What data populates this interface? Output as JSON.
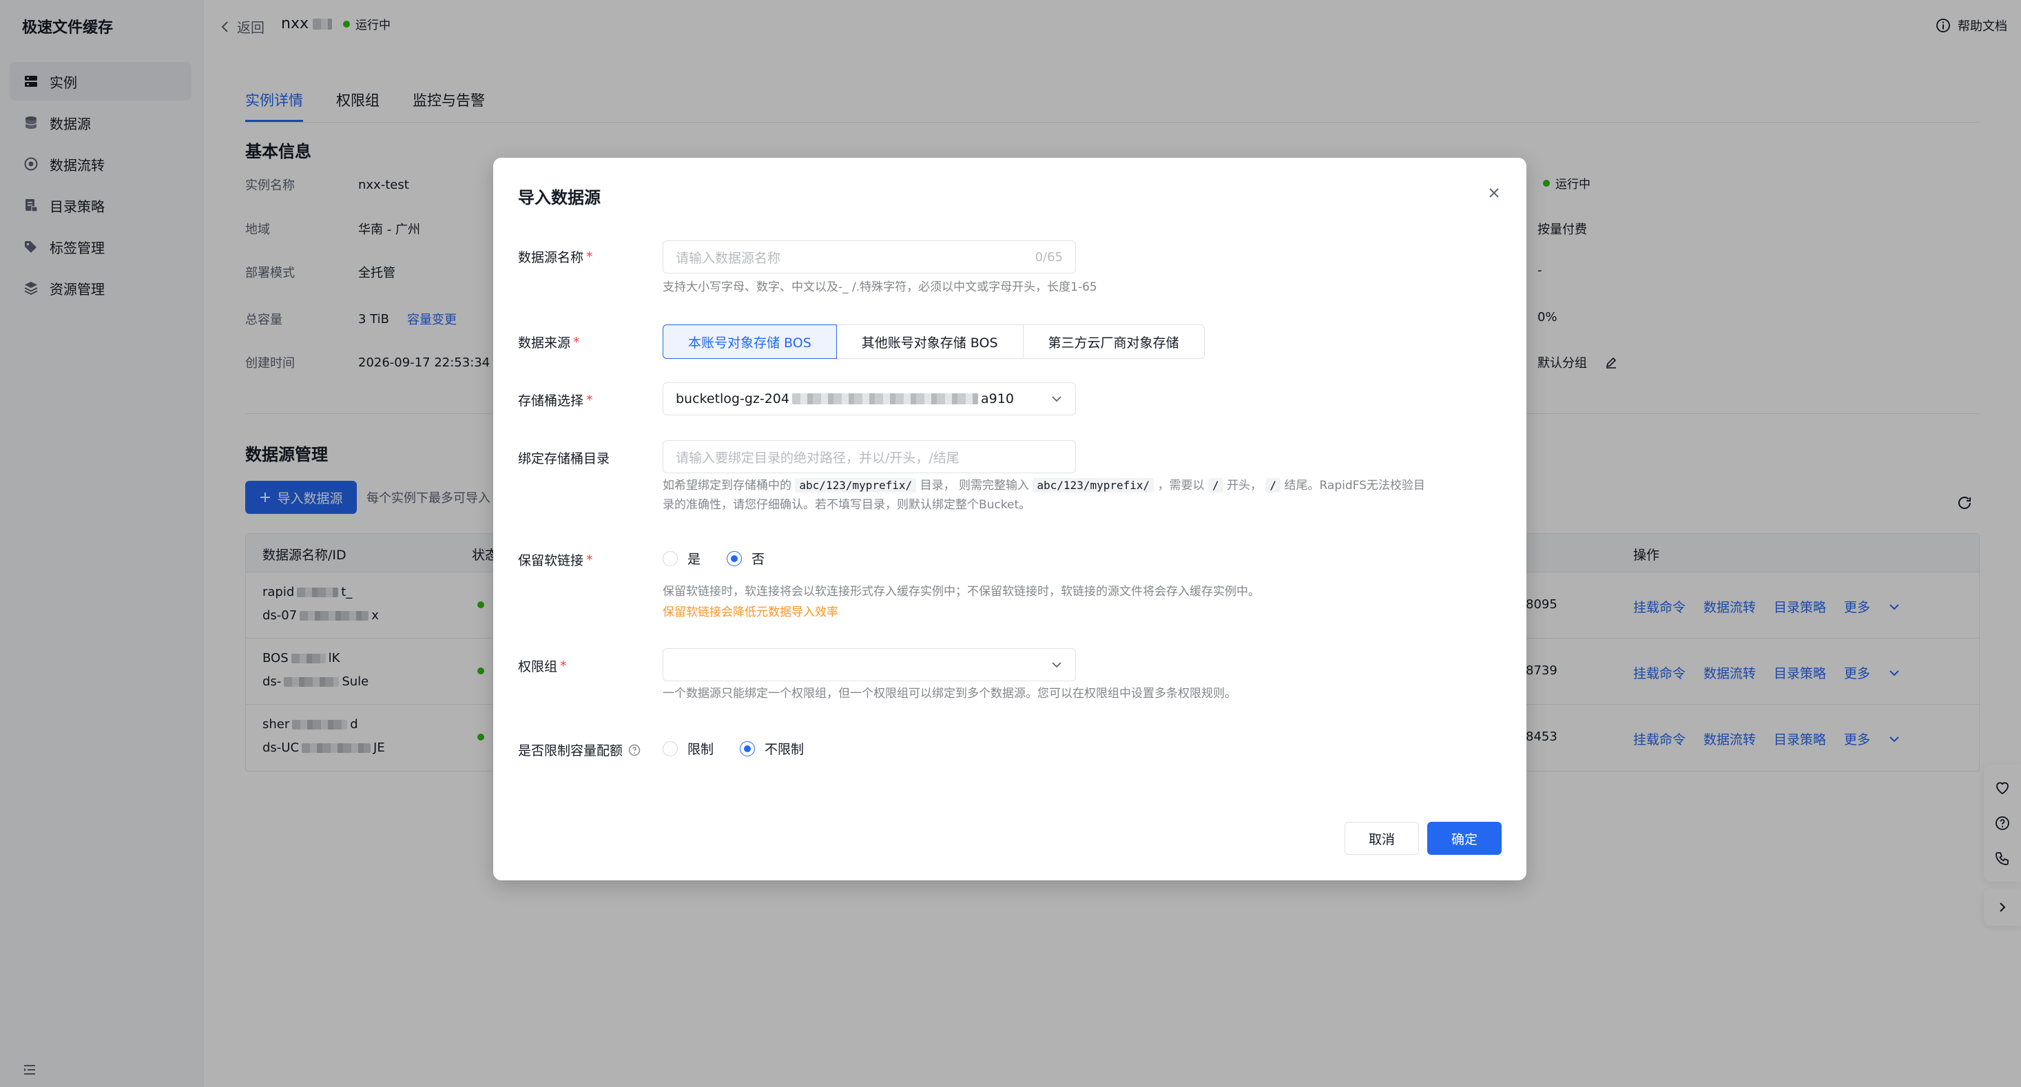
{
  "app": {
    "title": "极速文件缓存"
  },
  "sidebar": {
    "items": [
      {
        "label": "实例",
        "icon": "instance-icon",
        "active": true
      },
      {
        "label": "数据源",
        "icon": "database-icon",
        "active": false
      },
      {
        "label": "数据流转",
        "icon": "flow-icon",
        "active": false
      },
      {
        "label": "目录策略",
        "icon": "directory-icon",
        "active": false
      },
      {
        "label": "标签管理",
        "icon": "tag-icon",
        "active": false
      },
      {
        "label": "资源管理",
        "icon": "resource-icon",
        "active": false
      }
    ]
  },
  "header": {
    "back_label": "返回",
    "instance_name_prefix": "nxx",
    "status": "运行中",
    "help_label": "帮助文档"
  },
  "tabs": [
    {
      "label": "实例详情",
      "active": true
    },
    {
      "label": "权限组",
      "active": false
    },
    {
      "label": "监控与告警",
      "active": false
    }
  ],
  "basic_info": {
    "title": "基本信息",
    "left": [
      {
        "key": "实例名称",
        "value": "nxx-test"
      },
      {
        "key": "地域",
        "value": "华南 - 广州"
      },
      {
        "key": "部署模式",
        "value": "全托管"
      },
      {
        "key": "总容量",
        "value": "3 TiB",
        "link": "容量变更"
      },
      {
        "key": "创建时间",
        "value": "2026-09-17 22:53:34"
      }
    ],
    "right": [
      {
        "value": "运行中"
      },
      {
        "value": "按量付费"
      },
      {
        "value": "-"
      },
      {
        "value": "0%"
      },
      {
        "value": "默认分组"
      }
    ]
  },
  "datasource_mgmt": {
    "title": "数据源管理",
    "import_button": "导入数据源",
    "import_tip": "每个实例下最多可导入",
    "columns": {
      "name": "数据源名称/ID",
      "status": "状态",
      "ops": "操作"
    },
    "rows": [
      {
        "name_prefix": "rapid",
        "name_suffix": "t_",
        "id_prefix": "ds-07",
        "id_suffix": "x",
        "num": "8095"
      },
      {
        "name_prefix": "BOS",
        "name_suffix": "lK",
        "id_prefix": "ds-",
        "id_suffix": "Sule",
        "num": "8739"
      },
      {
        "name_prefix": "sher",
        "name_suffix": "d",
        "id_prefix": "ds-UC",
        "id_suffix": "JE",
        "num": "8453"
      }
    ],
    "ops": [
      "挂载命令",
      "数据流转",
      "目录策略",
      "更多"
    ]
  },
  "modal": {
    "title": "导入数据源",
    "name_field": {
      "label": "数据源名称",
      "placeholder": "请输入数据源名称",
      "counter": "0/65",
      "hint": "支持大小写字母、数字、中文以及-_ /.特殊字符，必须以中文或字母开头，长度1-65"
    },
    "source_field": {
      "label": "数据来源",
      "options": [
        "本账号对象存储 BOS",
        "其他账号对象存储 BOS",
        "第三方云厂商对象存储"
      ],
      "selected": "本账号对象存储 BOS"
    },
    "bucket_field": {
      "label": "存储桶选择",
      "value_prefix": "bucketlog-gz-204",
      "value_suffix": "a910"
    },
    "dir_field": {
      "label": "绑定存储桶目录",
      "placeholder": "请输入要绑定目录的绝对路径，并以/开头，/结尾",
      "hint_1": "如希望绑定到存储桶中的",
      "hint_code_1": "abc/123/myprefix/",
      "hint_2": "目录， 则需完整输入",
      "hint_code_2": "abc/123/myprefix/",
      "hint_3": "，需要以",
      "hint_code_3": "/",
      "hint_4": "开头，",
      "hint_code_4": "/",
      "hint_5": "结尾。RapidFS无法校验目",
      "hint_line2": "录的准确性，请您仔细确认。若不填写目录，则默认绑定整个Bucket。"
    },
    "symlink_field": {
      "label": "保留软链接",
      "options": [
        "是",
        "否"
      ],
      "selected": "否",
      "hint": "保留软链接时，软连接将会以软连接形式存入缓存实例中；不保留软链接时，软链接的源文件将会存入缓存实例中。",
      "warn": "保留软链接会降低元数据导入效率"
    },
    "perm_field": {
      "label": "权限组",
      "hint": "一个数据源只能绑定一个权限组，但一个权限组可以绑定到多个数据源。您可以在权限组中设置多条权限规则。"
    },
    "quota_field": {
      "label": "是否限制容量配额",
      "options": [
        "限制",
        "不限制"
      ],
      "selected": "不限制"
    },
    "cancel_label": "取消",
    "ok_label": "确定"
  },
  "colors": {
    "primary": "#2468f2",
    "success": "#30bf13",
    "warning": "#ff9326",
    "danger": "#f33e3e"
  }
}
